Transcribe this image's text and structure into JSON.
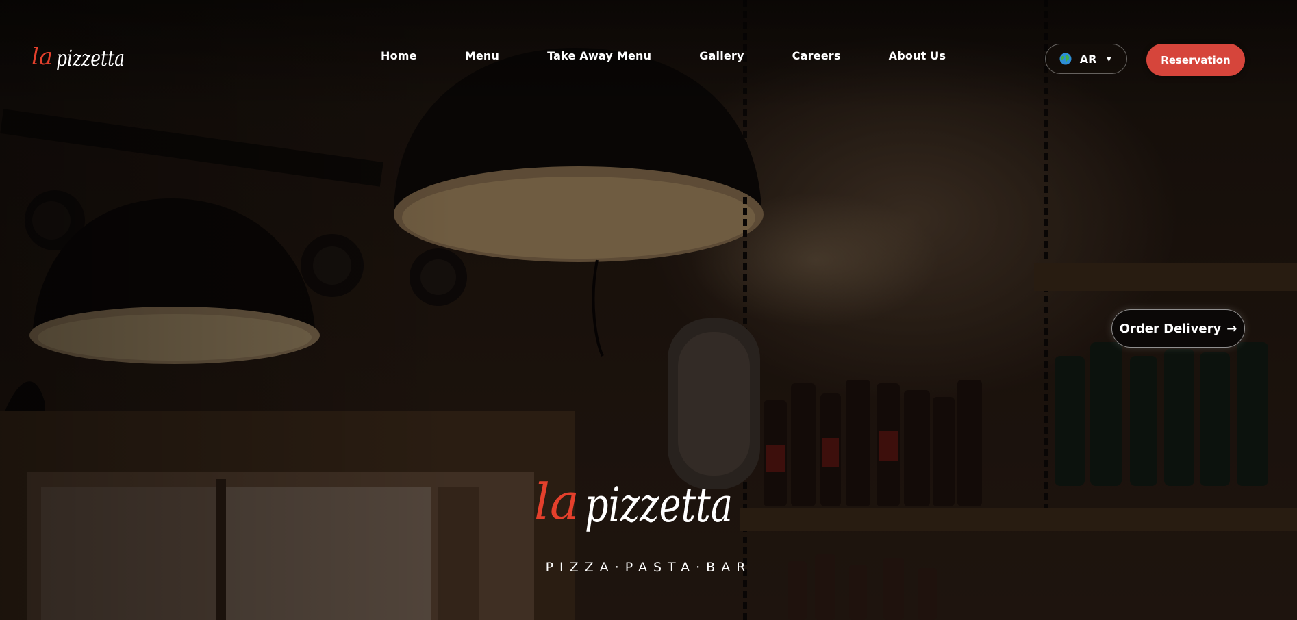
{
  "brand": {
    "logo_text": "la pizzetta",
    "logo_prefix": "la",
    "logo_word": "pizzetta",
    "tagline": "PIZZA·PASTA·BAR"
  },
  "nav": {
    "items": [
      {
        "label": "Home"
      },
      {
        "label": "Menu"
      },
      {
        "label": "Take Away Menu"
      },
      {
        "label": "Gallery"
      },
      {
        "label": "Careers"
      },
      {
        "label": "About Us"
      }
    ]
  },
  "language": {
    "code": "AR",
    "icon": "globe-icon",
    "caret": "▼"
  },
  "actions": {
    "reservation_label": "Reservation",
    "delivery_label": "Order Delivery",
    "delivery_arrow": "→"
  },
  "colors": {
    "accent": "#d6453b",
    "logo_accent": "#e4402c",
    "text": "#ffffff"
  }
}
